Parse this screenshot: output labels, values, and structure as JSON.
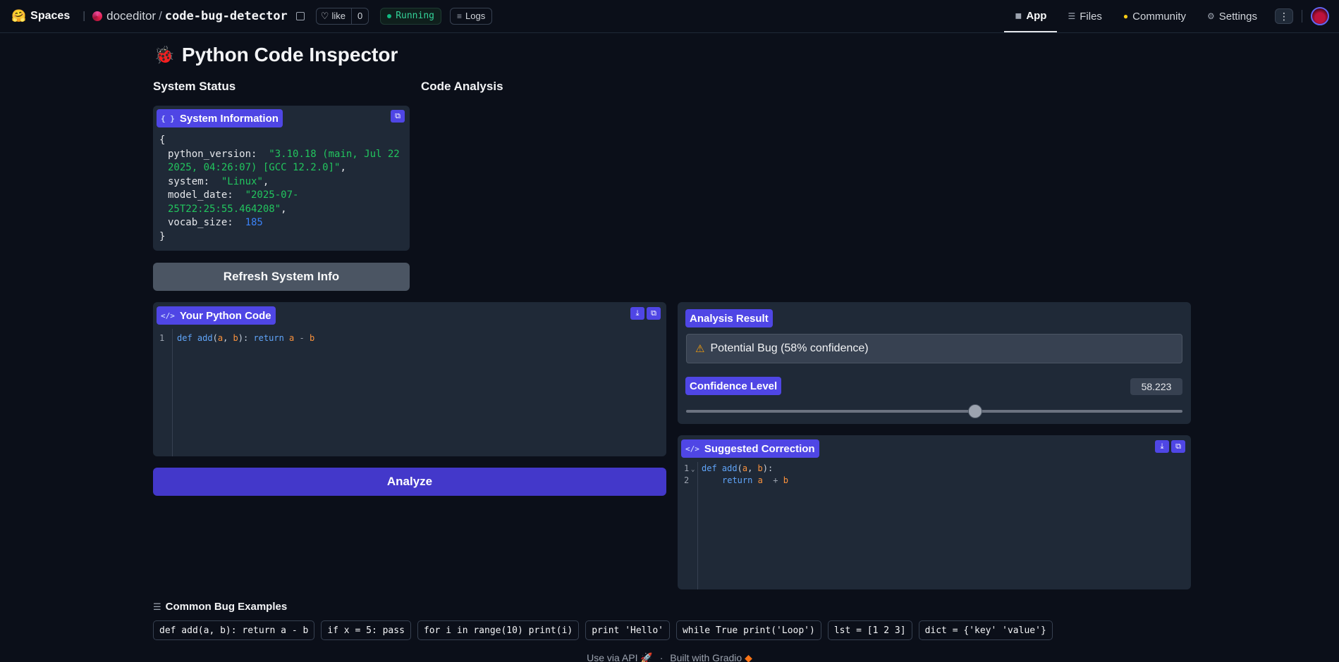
{
  "topbar": {
    "spaces_label": "Spaces",
    "owner": "doceditor",
    "repo": "code-bug-detector",
    "like_label": "like",
    "like_count": "0",
    "status": "Running",
    "logs_label": "Logs",
    "nav": [
      {
        "label": "App",
        "icon": "cube-icon"
      },
      {
        "label": "Files",
        "icon": "files-icon"
      },
      {
        "label": "Community",
        "icon": "community-icon"
      },
      {
        "label": "Settings",
        "icon": "gear-icon"
      }
    ]
  },
  "page": {
    "title": "Python Code Inspector",
    "system_status_heading": "System Status",
    "code_analysis_heading": "Code Analysis"
  },
  "system_info": {
    "label": "System Information",
    "python_version_key": "python_version:",
    "python_version_l1": "\"3.10.18 (main, Jul 22",
    "python_version_l2": "2025, 04:26:07) [GCC 12.2.0]\"",
    "system_key": "system:",
    "system_val": "\"Linux\"",
    "model_date_key": "model_date:",
    "model_date_l1": "\"2025-07-",
    "model_date_l2": "25T22:25:55.464208\"",
    "vocab_size_key": "vocab_size:",
    "vocab_size_val": "185",
    "refresh_label": "Refresh System Info"
  },
  "code_input": {
    "label": "Your Python Code",
    "line_no": "1",
    "tokens": {
      "def": "def",
      "name": "add",
      "open": "(",
      "a": "a",
      "comma": ", ",
      "b": "b",
      "close": "):",
      "ret": "return",
      "a2": "a",
      "minus": " - ",
      "b2": "b"
    },
    "analyze_label": "Analyze"
  },
  "analysis": {
    "label": "Analysis Result",
    "result_text": "Potential Bug (58% confidence)",
    "confidence_label": "Confidence Level",
    "confidence_value": "58.223",
    "confidence_fraction": 0.58223
  },
  "correction": {
    "label": "Suggested Correction",
    "line1_no": "1",
    "line2_no": "2",
    "tokens": {
      "def": "def",
      "name": "add",
      "open": "(",
      "a": "a",
      "comma": ", ",
      "b": "b",
      "close": "):",
      "ret": "return",
      "a2": "a",
      "plus": "  + ",
      "b2": "b"
    }
  },
  "examples": {
    "heading": "Common Bug Examples",
    "items": [
      "def add(a, b): return a - b",
      "if x = 5: pass",
      "for i in range(10) print(i)",
      "print 'Hello'",
      "while True print('Loop')",
      "lst = [1 2 3]",
      "dict = {'key' 'value'}"
    ]
  },
  "footer": {
    "api_label": "Use via API",
    "dot": "·",
    "built_label": "Built with Gradio"
  },
  "colors": {
    "background": "#0b0f19",
    "panel": "#1f2937",
    "accent": "#4f46e5",
    "string": "#22c55e",
    "number": "#3b82f6"
  }
}
